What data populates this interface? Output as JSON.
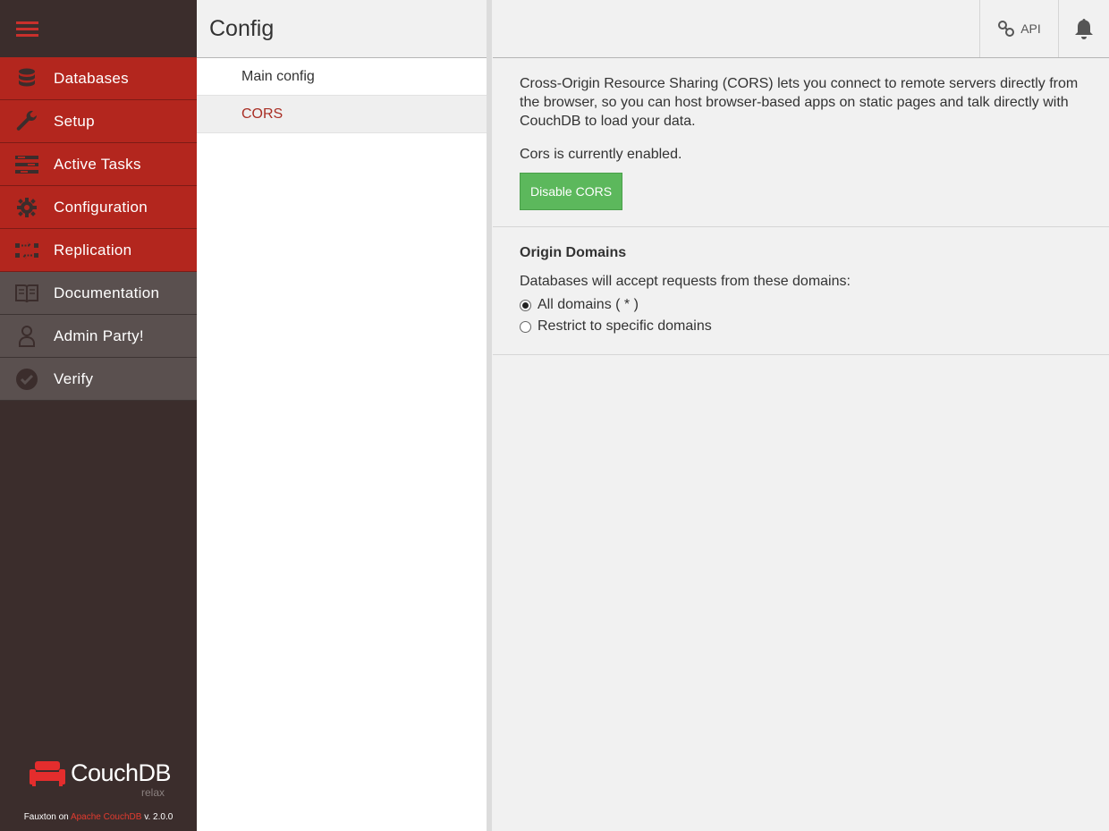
{
  "nav": {
    "items": [
      {
        "label": "Databases",
        "icon": "database-icon"
      },
      {
        "label": "Setup",
        "icon": "wrench-icon"
      },
      {
        "label": "Active Tasks",
        "icon": "tasks-icon"
      },
      {
        "label": "Configuration",
        "icon": "gear-icon"
      },
      {
        "label": "Replication",
        "icon": "replication-icon"
      },
      {
        "label": "Documentation",
        "icon": "book-icon"
      },
      {
        "label": "Admin Party!",
        "icon": "user-icon"
      },
      {
        "label": "Verify",
        "icon": "check-circle-icon"
      }
    ],
    "logo_text": "CouchDB",
    "logo_tagline": "relax",
    "footer": {
      "prefix": "Fauxton on ",
      "link": "Apache CouchDB",
      "suffix": " v. 2.0.0"
    }
  },
  "sidebar": {
    "title": "Config",
    "items": [
      {
        "label": "Main config"
      },
      {
        "label": "CORS"
      }
    ]
  },
  "header": {
    "api_label": "API"
  },
  "cors": {
    "description": "Cross-Origin Resource Sharing (CORS) lets you connect to remote servers directly from the browser, so you can host browser-based apps on static pages and talk directly with CouchDB to load your data.",
    "status": "Cors is currently enabled.",
    "toggle_label": "Disable CORS"
  },
  "origins": {
    "title": "Origin Domains",
    "subtitle": "Databases will accept requests from these domains:",
    "options": [
      {
        "label": "All domains ( * )",
        "selected": true
      },
      {
        "label": "Restrict to specific domains",
        "selected": false
      }
    ]
  },
  "colors": {
    "nav_red": "#b3261e",
    "nav_gray": "#5a504f",
    "nav_bg": "#3b2d2c",
    "accent": "#a92e24",
    "button_green": "#5cb85c"
  }
}
